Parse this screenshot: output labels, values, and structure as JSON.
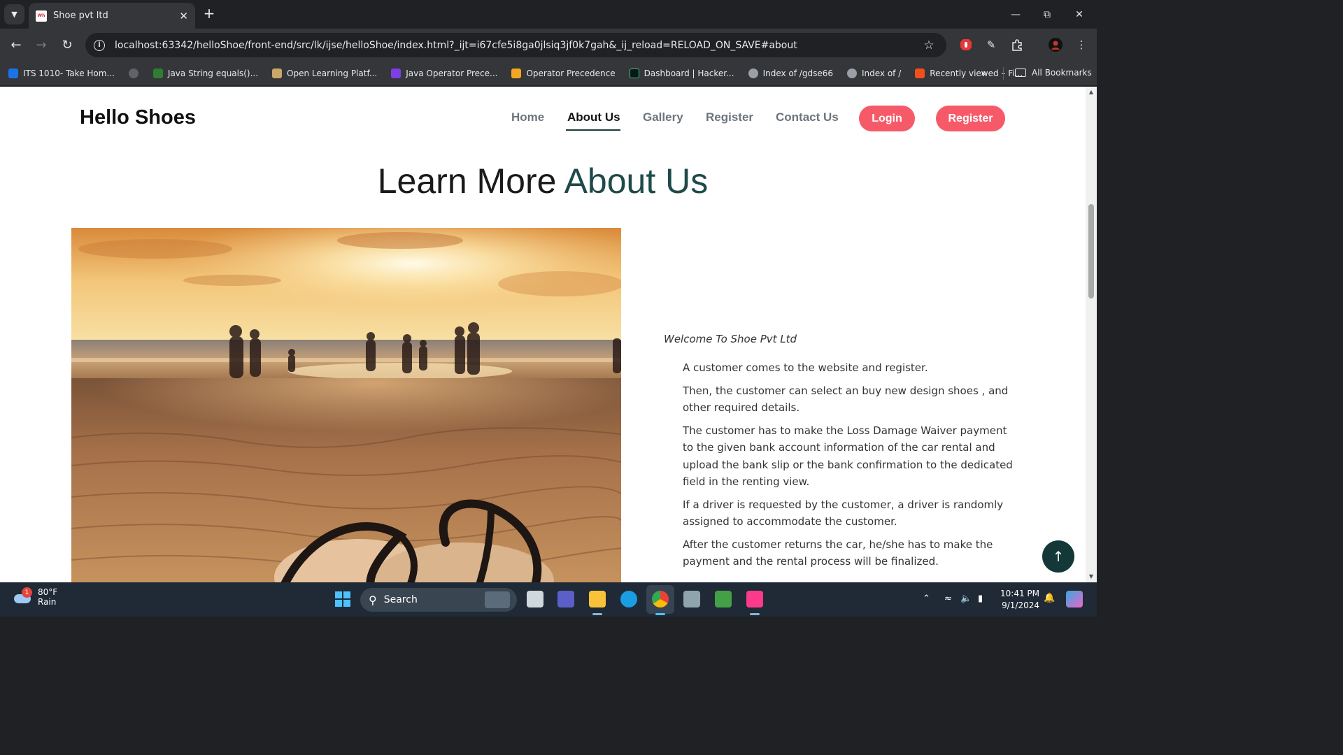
{
  "browser": {
    "tab": {
      "favicon_text": "Wh",
      "title": "Shoe pvt ltd"
    },
    "url": "localhost:63342/helloShoe/front-end/src/lk/ijse/helloShoe/index.html?_ijt=i67cfe5i8ga0jlsiq3jf0k7gah&_ij_reload=RELOAD_ON_SAVE#about",
    "bookmarks": [
      {
        "label": "ITS 1010- Take Hom...",
        "color": "#1a73e8"
      },
      {
        "label": "",
        "color": "#5f6368"
      },
      {
        "label": "Java String equals()...",
        "color": "#2e7d32"
      },
      {
        "label": "Open Learning Platf...",
        "color": "#c9a86a"
      },
      {
        "label": "Java Operator Prece...",
        "color": "#7b3fe4"
      },
      {
        "label": "Operator Precedence",
        "color": "#f5a623"
      },
      {
        "label": "Dashboard | Hacker...",
        "color": "#0e141e"
      },
      {
        "label": "Index of /gdse66",
        "color": "#9aa0a6"
      },
      {
        "label": "Index of /",
        "color": "#9aa0a6"
      },
      {
        "label": "Recently viewed – Fi...",
        "color": "#f24e1e"
      }
    ],
    "all_bookmarks": "All Bookmarks"
  },
  "site": {
    "brand": "Hello Shoes",
    "nav": [
      {
        "label": "Home",
        "active": false
      },
      {
        "label": "About Us",
        "active": true
      },
      {
        "label": "Gallery",
        "active": false
      },
      {
        "label": "Register",
        "active": false
      },
      {
        "label": "Contact Us",
        "active": false
      }
    ],
    "login_button": "Login",
    "register_button": "Register",
    "heading_plain": "Learn More ",
    "heading_highlight": "About Us",
    "welcome": "Welcome To Shoe Pvt Ltd",
    "steps": [
      "A customer comes to the website and register.",
      "Then, the customer can select an buy new design shoes , and other required details.",
      "The customer has to make the Loss Damage Waiver payment to the given bank account information of the car rental and upload the bank slip or the bank confirmation to the dedicated field in the renting view.",
      "If a driver is requested by the customer, a driver is randomly assigned to accommodate the customer.",
      "After the customer returns the car, he/she has to make the payment and the rental process will be finalized."
    ],
    "colors": {
      "accent_pill": "#f65a69",
      "heading_highlight": "#1f4a4a",
      "back_to_top": "#143838"
    }
  },
  "taskbar": {
    "weather_temp": "80°F",
    "weather_desc": "Rain",
    "weather_badge": "1",
    "search_label": "Search",
    "time": "10:41 PM",
    "date": "9/1/2024"
  }
}
